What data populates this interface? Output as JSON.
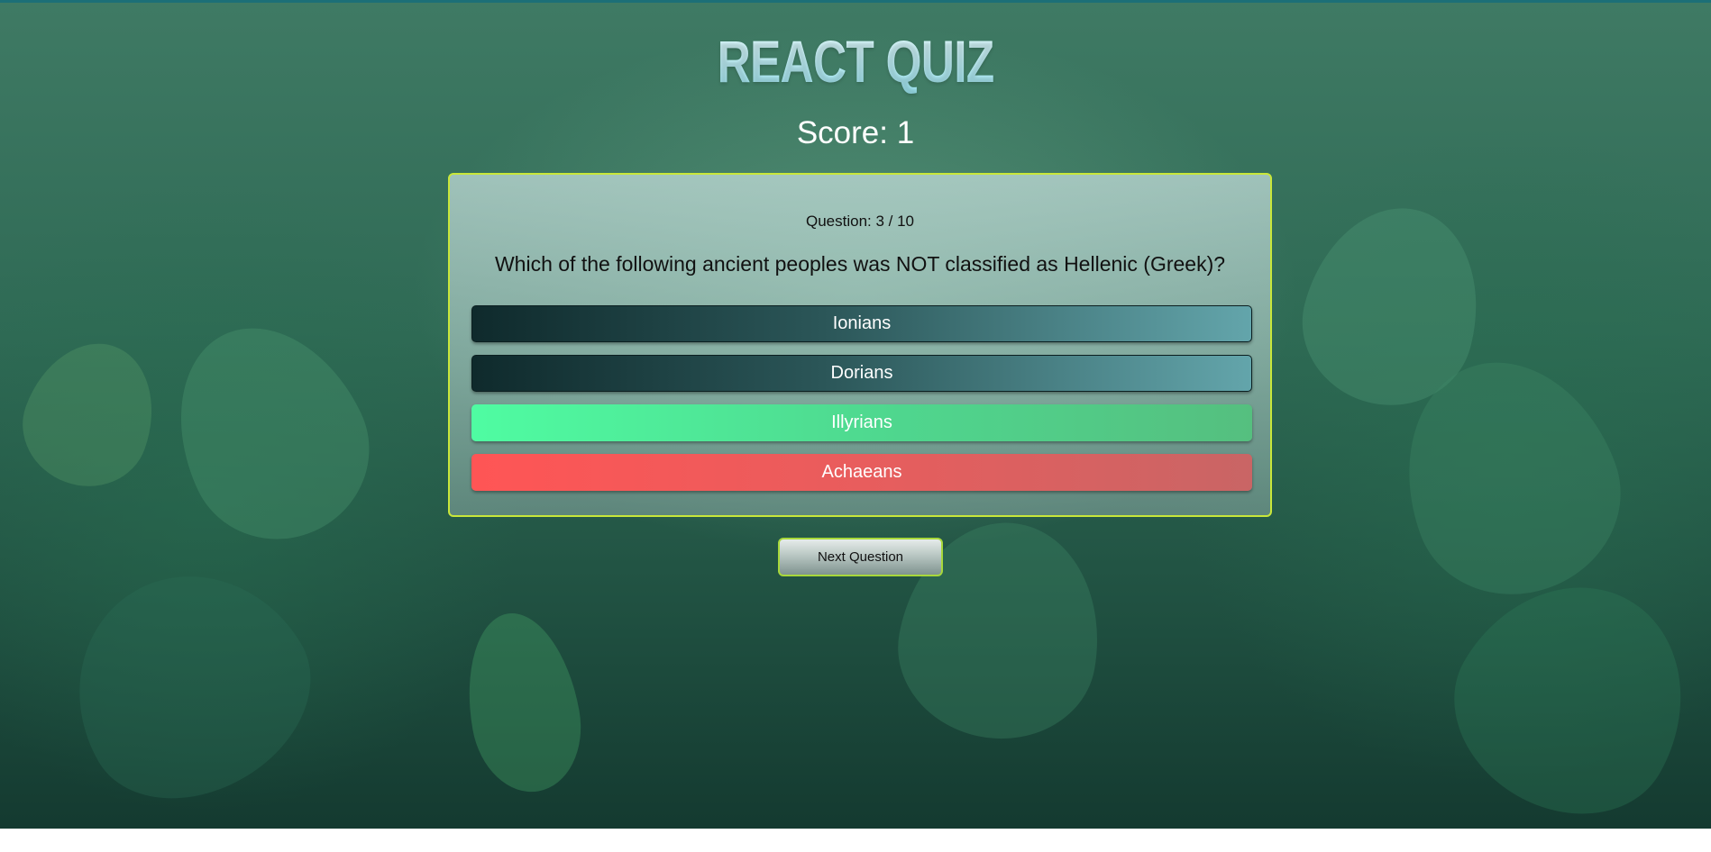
{
  "app": {
    "title": "REACT QUIZ"
  },
  "score": {
    "label": "Score: 1",
    "value": 1
  },
  "question": {
    "counter": "Question: 3 / 10",
    "current": 3,
    "total": 10,
    "text": "Which of the following ancient peoples was NOT classified as Hellenic (Greek)?",
    "answers": [
      {
        "label": "Ionians",
        "state": "unselected"
      },
      {
        "label": "Dorians",
        "state": "unselected"
      },
      {
        "label": "Illyrians",
        "state": "correct"
      },
      {
        "label": "Achaeans",
        "state": "incorrect"
      }
    ]
  },
  "actions": {
    "next_label": "Next Question"
  },
  "colors": {
    "card_border": "#c9e73a",
    "correct": "#4ffca2",
    "incorrect": "#ff5555",
    "neutral": "#2b5658",
    "title": "#c9f6fb"
  }
}
